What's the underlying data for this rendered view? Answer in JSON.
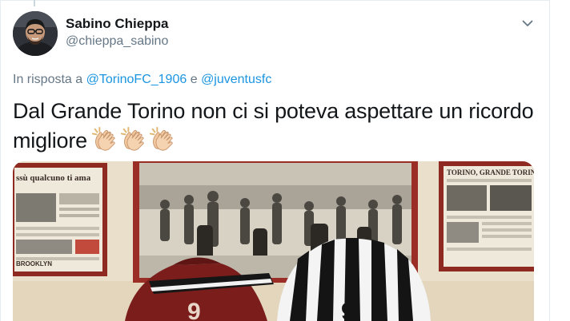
{
  "tweet": {
    "author": {
      "display_name": "Sabino Chieppa",
      "username": "@chieppa_sabino"
    },
    "reply": {
      "prefix": "In risposta a",
      "mentions": [
        "@TorinoFC_1906",
        "@juventusfc"
      ],
      "joiner": "e"
    },
    "text": "Dal Grande Torino non ci si poteva aspettare un ricordo migliore",
    "emojis": [
      "clapping-hands-emoji",
      "clapping-hands-emoji",
      "clapping-hands-emoji"
    ],
    "media": {
      "left_frame": {
        "headline": "ssù qualcuno ti ama",
        "footer": "BROOKLYN"
      },
      "right_frame": {
        "headline": "TORINO, GRANDE TORIN"
      }
    }
  },
  "icons": {
    "caret": "chevron-down-icon"
  },
  "colors": {
    "link": "#1b95e0",
    "secondary_text": "#657786",
    "primary_text": "#14171a",
    "border": "#e6ecf0"
  }
}
